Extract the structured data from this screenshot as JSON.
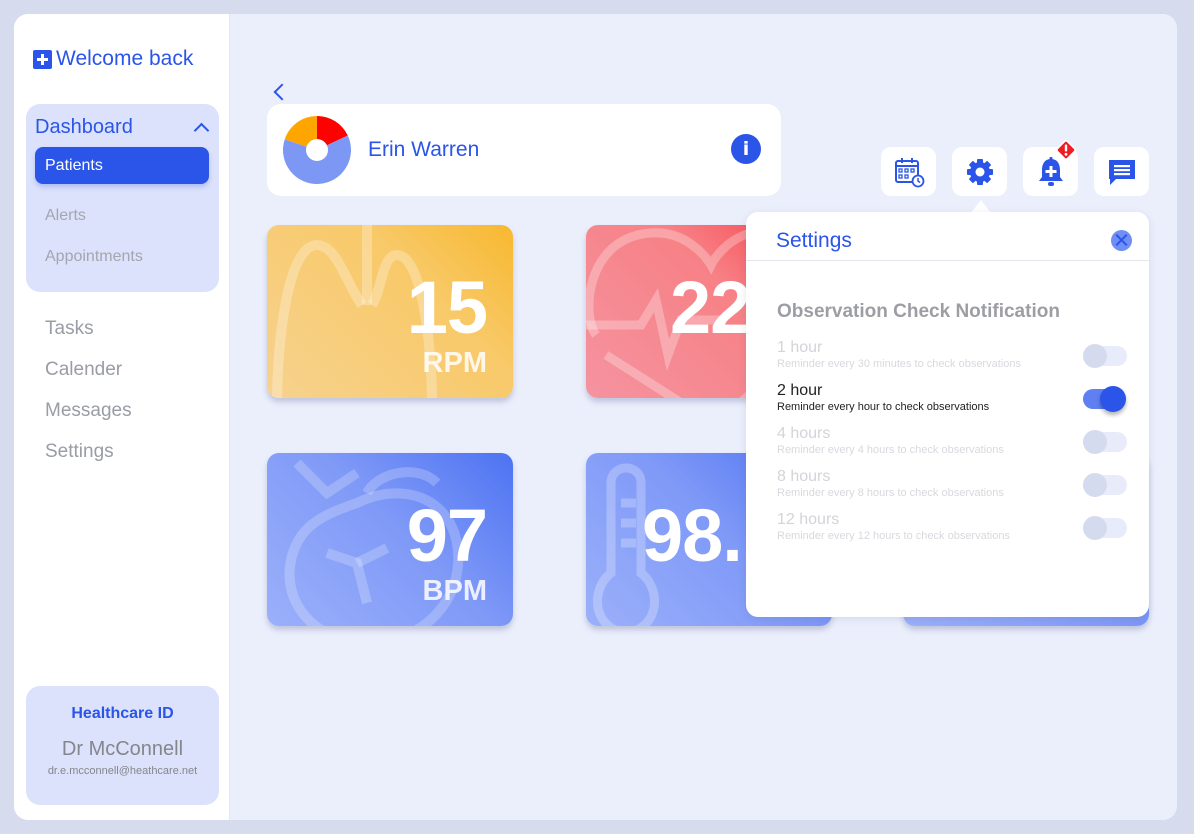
{
  "sidebar": {
    "brand": "Welcome back",
    "dashboard_label": "Dashboard",
    "dashboard_items": [
      {
        "label": "Patients",
        "active": true
      },
      {
        "label": "Alerts",
        "active": false
      },
      {
        "label": "Appointments",
        "active": false
      }
    ],
    "nav_items": [
      {
        "label": "Tasks"
      },
      {
        "label": "Calender"
      },
      {
        "label": "Messages"
      },
      {
        "label": "Settings"
      }
    ],
    "id_card": {
      "title": "Healthcare ID",
      "name": "Dr McConnell",
      "email": "dr.e.mcconnell@heathcare.net"
    }
  },
  "patient": {
    "name": "Erin Warren",
    "status_chart": {
      "segments": [
        {
          "name": "orange",
          "fraction": 0.2,
          "color": "#ffa500"
        },
        {
          "name": "red",
          "fraction": 0.18,
          "color": "#ff0000"
        },
        {
          "name": "blue",
          "fraction": 0.62,
          "color": "#7d97f5"
        }
      ]
    }
  },
  "toolbar": {
    "icons": [
      "calendar-clock-icon",
      "gear-icon",
      "bell-plus-icon",
      "message-icon"
    ],
    "alert_badge": "!"
  },
  "vitals": [
    {
      "name": "respiration",
      "value": "15",
      "unit": "RPM"
    },
    {
      "name": "blood-pressure",
      "value": "22",
      "unit": ""
    },
    {
      "name": "heart-rate",
      "value": "97",
      "unit": "BPM"
    },
    {
      "name": "temperature",
      "value": "98.",
      "unit": ""
    }
  ],
  "settings": {
    "title": "Settings",
    "section_title": "Observation Check Notification",
    "options": [
      {
        "title": "1 hour",
        "desc": "Reminder every 30 minutes to check  observations",
        "enabled": false
      },
      {
        "title": "2 hour",
        "desc": "Reminder every hour to check  observations",
        "enabled": true
      },
      {
        "title": "4 hours",
        "desc": "Reminder every 4 hours to check  observations",
        "enabled": false
      },
      {
        "title": "8 hours",
        "desc": "Reminder every 8 hours to check  observations",
        "enabled": false
      },
      {
        "title": "12 hours",
        "desc": "Reminder every 12 hours to check  observations",
        "enabled": false
      }
    ]
  },
  "colors": {
    "accent": "#2a55e8",
    "sidebar_group_bg": "#dce2fb",
    "app_bg": "#ebeffc"
  }
}
